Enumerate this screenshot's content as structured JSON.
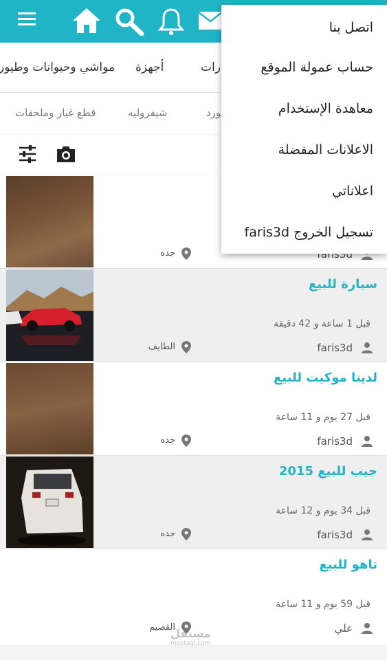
{
  "colors": {
    "accent": "#1fb5c6",
    "header": "#1fb5c6"
  },
  "header": {
    "icons": [
      "menu-icon",
      "home-icon",
      "search-icon",
      "bell-icon",
      "mail-icon"
    ]
  },
  "categories": [
    "مواشي وحيوانات وطيور",
    "أجهزة",
    "عقارات"
  ],
  "subcategories": [
    "قطع غيار وملحقات",
    "شيفروليه",
    "فورد"
  ],
  "tools": [
    "filter-icon",
    "camera-icon"
  ],
  "menu": {
    "items": [
      "اتصل بنا",
      "حساب عمولة الموقع",
      "معاهدة الإستخدام",
      "الاعلانات المفضلة",
      "اعلاناتي",
      "تسجيل الخروج faris3d"
    ]
  },
  "listings": [
    {
      "title": "",
      "time": "",
      "user": "faris3d",
      "city": "جده"
    },
    {
      "title": "سيارة للبيع",
      "time": "قبل 1 ساعة و 42 دقيقة",
      "user": "faris3d",
      "city": "الطايف"
    },
    {
      "title": "لدينا موكيت للبيع",
      "time": "قبل 27 يوم و 11 ساعة",
      "user": "faris3d",
      "city": "جده"
    },
    {
      "title": "جيب للبيع 2015",
      "time": "قبل 34 يوم و 12 ساعة",
      "user": "faris3d",
      "city": "جده"
    },
    {
      "title": "تاهو للبيع",
      "time": "قبل 59 يوم و 11 ساعة",
      "user": "علي",
      "city": "القصيم"
    }
  ],
  "watermark": {
    "name": "مستقل",
    "domain": "mostaql.com"
  }
}
